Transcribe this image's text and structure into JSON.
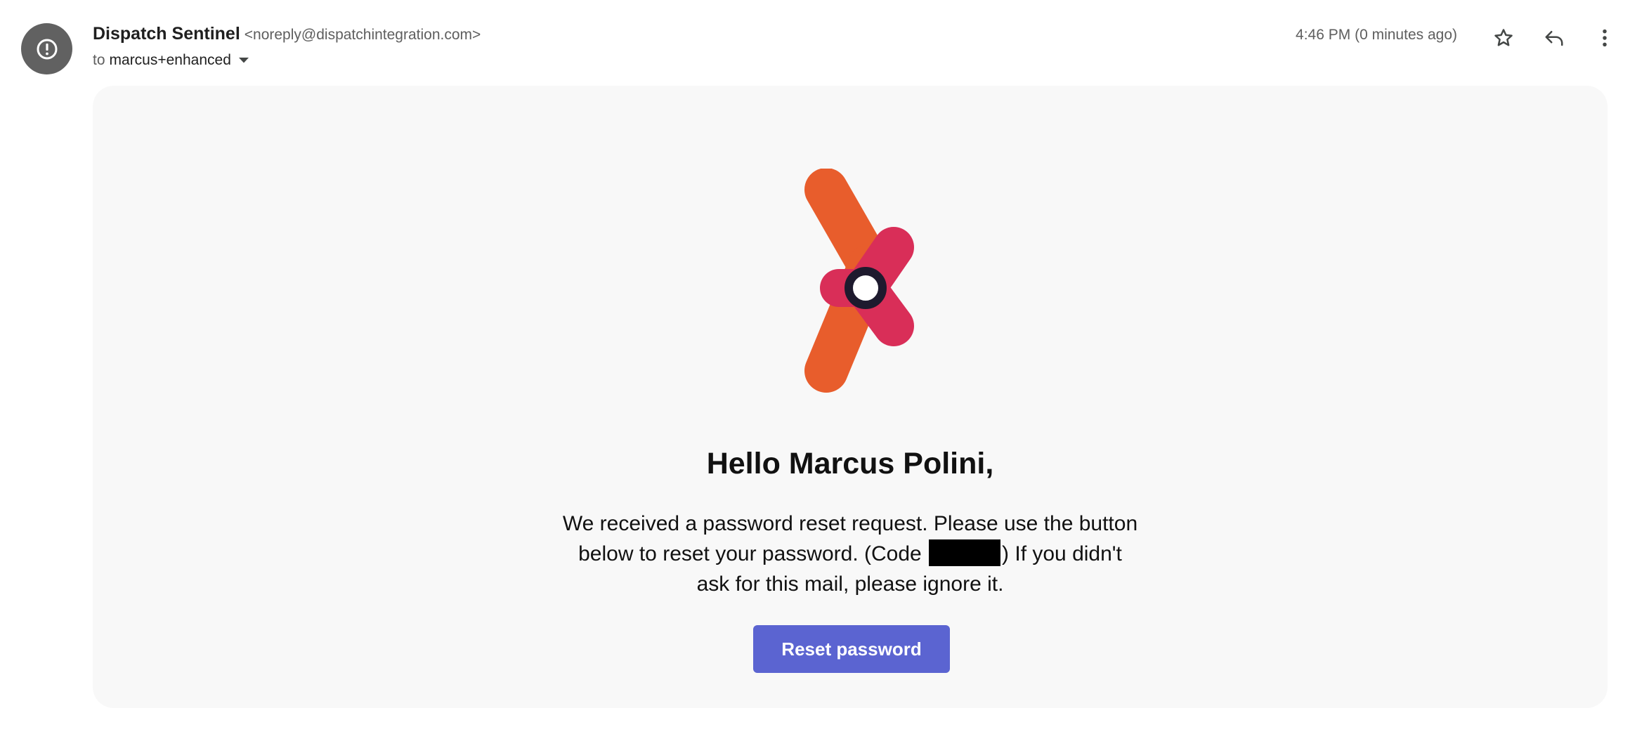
{
  "sender": {
    "avatar_icon": "alert-circle-icon",
    "name": "Dispatch Sentinel",
    "email": "<noreply@dispatchintegration.com>"
  },
  "recipient": {
    "prefix": "to",
    "name": "marcus+enhanced",
    "caret_icon": "caret-down-icon"
  },
  "timestamp": "4:46 PM (0 minutes ago)",
  "actions": {
    "star_icon": "star-icon",
    "reply_icon": "reply-icon",
    "more_icon": "more-vertical-icon"
  },
  "email_body": {
    "logo_icon": "dispatch-logo-icon",
    "greeting": "Hello Marcus Polini,",
    "message_part1": "We received a password reset request. Please use the button below to reset your password. (Code ",
    "message_part2": ") If you didn't ask for this mail, please ignore it.",
    "button_label": "Reset password"
  },
  "colors": {
    "avatar_bg": "#616161",
    "card_bg": "#f8f8f8",
    "logo_orange": "#e85d2c",
    "logo_pink": "#d92e58",
    "logo_ring": "#1e1a2e",
    "button_bg": "#5b64d1",
    "redaction": "#000000"
  }
}
